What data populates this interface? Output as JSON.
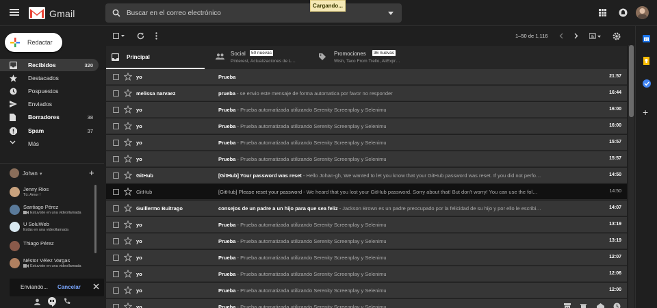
{
  "app": {
    "name": "Gmail",
    "loading_label": "Cargando..."
  },
  "search": {
    "placeholder": "Buscar en el correo electrónico"
  },
  "compose": {
    "label": "Redactar"
  },
  "sidebar": {
    "items": [
      {
        "label": "Recibidos",
        "count": "320",
        "icon": "inbox-icon",
        "bold": true,
        "active": true
      },
      {
        "label": "Destacados",
        "count": "",
        "icon": "star-icon"
      },
      {
        "label": "Pospuestos",
        "count": "",
        "icon": "clock-icon"
      },
      {
        "label": "Enviados",
        "count": "",
        "icon": "send-icon"
      },
      {
        "label": "Borradores",
        "count": "38",
        "icon": "draft-icon",
        "bold": true
      },
      {
        "label": "Spam",
        "count": "37",
        "icon": "spam-icon",
        "bold": true
      },
      {
        "label": "Más",
        "count": "",
        "icon": "chevron-down-icon"
      }
    ]
  },
  "hangouts": {
    "user": "Johan",
    "contacts": [
      {
        "name": "Jenny Rios",
        "status": "Tú: Amor !",
        "color": "#c9a27e"
      },
      {
        "name": "Santiago Pérez",
        "status": "Estuviste en una videollamada",
        "color": "#5a7a9a",
        "video": true
      },
      {
        "name": "U SoluWeb",
        "status": "Estás en una videollamada",
        "color": "#d8e8f0"
      },
      {
        "name": "Thiago Pérez",
        "status": "",
        "color": "#8a5a4a"
      },
      {
        "name": "Néstor Vélez Vargas",
        "status": "Estuviste en una videollamada",
        "color": "#b08060",
        "video": true
      }
    ]
  },
  "toast": {
    "text": "Enviando...",
    "action": "Cancelar"
  },
  "toolbar": {
    "pagination": "1–50 de 1,116"
  },
  "tabs": [
    {
      "label": "Principal",
      "badge": "",
      "sub": "",
      "icon": "inbox-tab-icon"
    },
    {
      "label": "Social",
      "badge": "50 nuevas",
      "sub": "Pinterest, Actualizaciones de L…",
      "icon": "people-icon"
    },
    {
      "label": "Promociones",
      "badge": "36 nuevas",
      "sub": "Wish, Taco From Trello, AliExpr…",
      "icon": "tag-icon"
    }
  ],
  "emails": [
    {
      "sender": "yo",
      "subject": "Prueba",
      "snippet": "",
      "time": "21:57",
      "read": false
    },
    {
      "sender": "melissa narvaez",
      "subject": "prueba",
      "snippet": " - se envio este mensaje de forma automatica por favor no responder",
      "time": "16:44",
      "read": false
    },
    {
      "sender": "yo",
      "subject": "Prueba",
      "snippet": " - Prueba automatizada utilizando Serenity Screenplay y Selenimu",
      "time": "16:00",
      "read": false
    },
    {
      "sender": "yo",
      "subject": "Prueba",
      "snippet": " - Prueba automatizada utilizando Serenity Screenplay y Selenimu",
      "time": "16:00",
      "read": false
    },
    {
      "sender": "yo",
      "subject": "Prueba",
      "snippet": " - Prueba automatizada utilizando Serenity Screenplay y Selenimu",
      "time": "15:57",
      "read": false
    },
    {
      "sender": "yo",
      "subject": "Prueba",
      "snippet": " - Prueba automatizada utilizando Serenity Screenplay y Selenimu",
      "time": "15:57",
      "read": false
    },
    {
      "sender": "GitHub",
      "subject": "[GitHub] Your password was reset",
      "snippet": " - Hello Johan-gh, We wanted to let you know that your GitHub password was reset. If you did not perfo…",
      "time": "14:50",
      "read": false
    },
    {
      "sender": "GitHub",
      "subject": "[GitHub] Please reset your password",
      "snippet": " - We heard that you lost your GitHub password. Sorry about that! But don't worry! You can use the fol…",
      "time": "14:50",
      "read": true
    },
    {
      "sender": "Guillermo Buitrago",
      "subject": "consejos de un padre a un hijo para que sea feliz",
      "snippet": " - Jackson Brown es un padre preocupado por la felicidad de su hijo y por ello le escribi…",
      "time": "14:07",
      "read": false
    },
    {
      "sender": "yo",
      "subject": "Prueba",
      "snippet": " - Prueba automatizada utilizando Serenity Screenplay y Selenimu",
      "time": "13:19",
      "read": false
    },
    {
      "sender": "yo",
      "subject": "Prueba",
      "snippet": " - Prueba automatizada utilizando Serenity Screenplay y Selenimu",
      "time": "13:19",
      "read": false
    },
    {
      "sender": "yo",
      "subject": "Prueba",
      "snippet": " - Prueba automatizada utilizando Serenity Screenplay y Selenimu",
      "time": "12:07",
      "read": false
    },
    {
      "sender": "yo",
      "subject": "Prueba",
      "snippet": " - Prueba automatizada utilizando Serenity Screenplay y Selenimu",
      "time": "12:06",
      "read": false
    },
    {
      "sender": "yo",
      "subject": "Prueba",
      "snippet": " - Prueba automatizada utilizando Serenity Screenplay y Selenimu",
      "time": "12:00",
      "read": false
    },
    {
      "sender": "yo",
      "subject": "Prueba",
      "snippet": " - Prueba automatizada utilizando Serenity Screenplay y Selenimu",
      "time": "",
      "read": false
    }
  ],
  "colors": {
    "accent": "#ea4335",
    "calendar": "#1a73e8",
    "keep": "#fbbc04",
    "tasks": "#4285f4"
  }
}
